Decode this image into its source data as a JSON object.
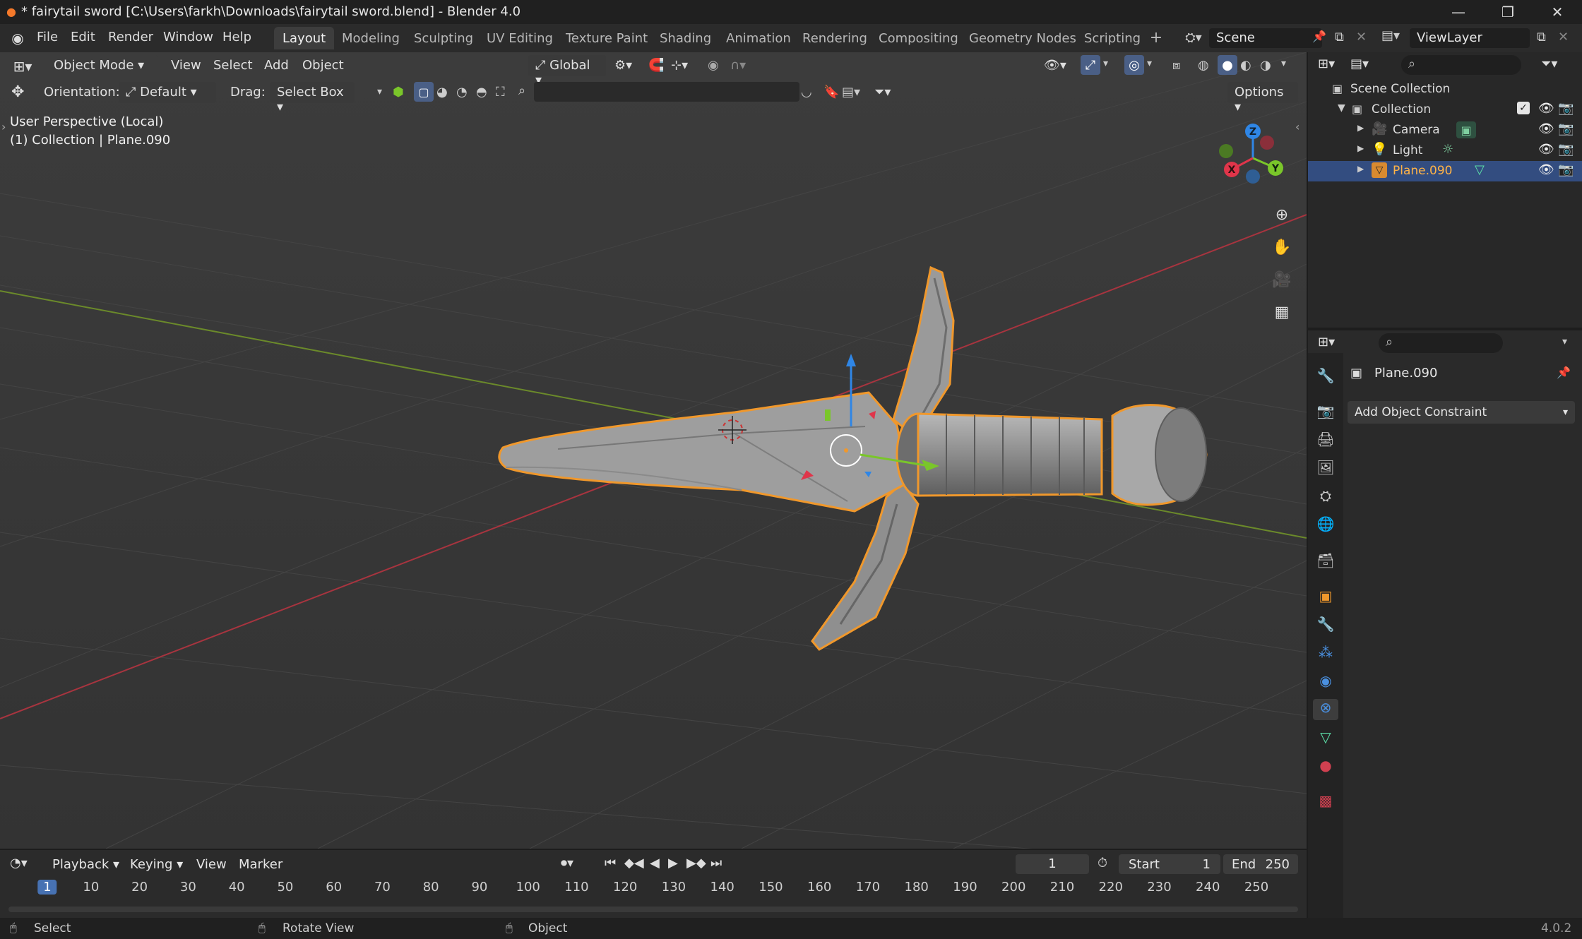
{
  "window": {
    "title": "* fairytail sword [C:\\Users\\farkh\\Downloads\\fairytail sword.blend] - Blender 4.0",
    "controls": [
      "—",
      "❐",
      "✕"
    ]
  },
  "menubar": {
    "menus": [
      "File",
      "Edit",
      "Render",
      "Window",
      "Help"
    ],
    "workspaces": [
      "Layout",
      "Modeling",
      "Sculpting",
      "UV Editing",
      "Texture Paint",
      "Shading",
      "Animation",
      "Rendering",
      "Compositing",
      "Geometry Nodes",
      "Scripting"
    ],
    "active_workspace": "Layout",
    "scene": "Scene",
    "view_layer": "ViewLayer"
  },
  "viewport": {
    "mode": "Object Mode",
    "menus": [
      "View",
      "Select",
      "Add",
      "Object"
    ],
    "transform_orientation": "Global",
    "orientation_label": "Orientation:",
    "orientation_value": "Default",
    "drag_label": "Drag:",
    "drag_value": "Select Box",
    "options_label": "Options",
    "overlay_line1": "User Perspective (Local)",
    "overlay_line2": "(1) Collection | Plane.090",
    "axes": {
      "x": "X",
      "y": "Y",
      "z": "Z"
    },
    "colors": {
      "selection": "#f0982c",
      "x_axis": "#e0354a",
      "y_axis": "#7ac62a",
      "z_axis": "#2f86e6"
    }
  },
  "outliner": {
    "root": "Scene Collection",
    "collection": "Collection",
    "items": [
      {
        "name": "Camera"
      },
      {
        "name": "Light"
      },
      {
        "name": "Plane.090",
        "selected": true
      }
    ]
  },
  "properties": {
    "object_name": "Plane.090",
    "add_constraint_label": "Add Object Constraint"
  },
  "timeline": {
    "menus": [
      "Playback",
      "Keying",
      "View",
      "Marker"
    ],
    "current_frame": "1",
    "start_label": "Start",
    "start_value": "1",
    "end_label": "End",
    "end_value": "250",
    "ruler": [
      "1",
      "10",
      "20",
      "30",
      "40",
      "50",
      "60",
      "70",
      "80",
      "90",
      "100",
      "110",
      "120",
      "130",
      "140",
      "150",
      "160",
      "170",
      "180",
      "190",
      "200",
      "210",
      "220",
      "230",
      "240",
      "250"
    ]
  },
  "statusbar": {
    "select": "Select",
    "rotate": "Rotate View",
    "object": "Object",
    "version": "4.0.2"
  }
}
